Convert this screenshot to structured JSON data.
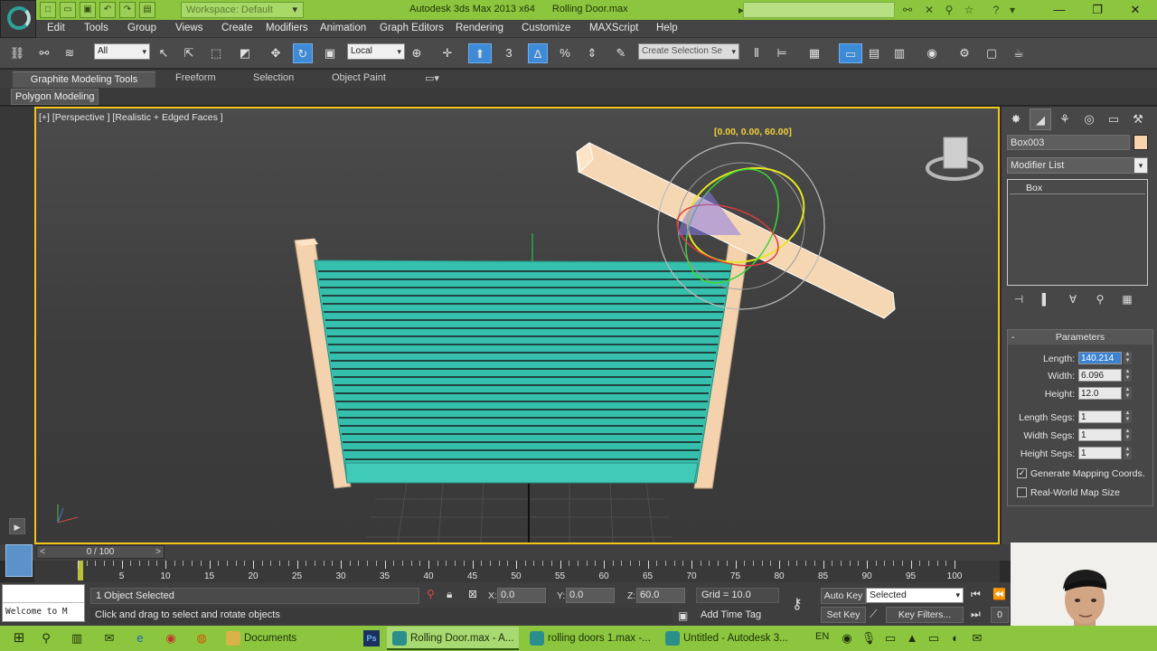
{
  "titlebar": {
    "workspace": "Workspace: Default",
    "app_title": "Autodesk 3ds Max  2013 x64",
    "file_title": "Rolling Door.max",
    "search_placeholder": ""
  },
  "menu": [
    "Edit",
    "Tools",
    "Group",
    "Views",
    "Create",
    "Modifiers",
    "Animation",
    "Graph Editors",
    "Rendering",
    "Customize",
    "MAXScript",
    "Help"
  ],
  "toolbar": {
    "selection_filter": "All",
    "ref_coord": "Local",
    "snap_label": "3",
    "angle_label": "%",
    "named_selection_placeholder": "Create Selection Se"
  },
  "ribbon": {
    "tabs": [
      "Graphite Modeling Tools",
      "Freeform",
      "Selection",
      "Object Paint"
    ],
    "panel_button": "Polygon Modeling"
  },
  "viewport": {
    "label": "[+] [Perspective ] [Realistic + Edged Faces ]",
    "gizmo_readout": "[0.00, 0.00, 60.00]"
  },
  "command_panel": {
    "object_name": "Box003",
    "object_color": "#f8d4ad",
    "modifier_list": "Modifier List",
    "stack_item": "Box",
    "rollout_title": "Parameters",
    "params": [
      {
        "label": "Length:",
        "value": "140.214"
      },
      {
        "label": "Width:",
        "value": "6.096"
      },
      {
        "label": "Height:",
        "value": "12.0"
      },
      {
        "label": "Length Segs:",
        "value": "1"
      },
      {
        "label": "Width Segs:",
        "value": "1"
      },
      {
        "label": "Height Segs:",
        "value": "1"
      }
    ],
    "checks": [
      {
        "label": "Generate Mapping Coords.",
        "checked": true
      },
      {
        "label": "Real-World Map Size",
        "checked": false
      }
    ]
  },
  "timeline": {
    "frame_readout": "0 / 100",
    "ticks": [
      "5",
      "10",
      "15",
      "20",
      "25",
      "30",
      "35",
      "40",
      "45",
      "50",
      "55",
      "60",
      "65",
      "70",
      "75",
      "80",
      "85",
      "90",
      "95",
      "100"
    ]
  },
  "status": {
    "maxscript_text": "Welcome to M",
    "selection": "1 Object Selected",
    "prompt": "Click and drag to select and rotate objects",
    "x_label": "X:",
    "x_value": "0.0",
    "y_label": "Y:",
    "y_value": "0.0",
    "z_label": "Z:",
    "z_value": "60.0",
    "grid": "Grid = 10.0",
    "add_time_tag": "Add Time Tag",
    "auto_key": "Auto Key",
    "set_key": "Set Key",
    "key_mode": "Selected",
    "key_filters": "Key Filters...",
    "frame_field": "0"
  },
  "taskbar": {
    "apps": [
      {
        "label": "Documents",
        "active": false
      },
      {
        "label": "Rolling Door.max - A...",
        "active": true
      },
      {
        "label": "rolling doors 1.max -...",
        "active": false
      },
      {
        "label": "Untitled - Autodesk 3...",
        "active": false
      }
    ],
    "language": "EN"
  }
}
